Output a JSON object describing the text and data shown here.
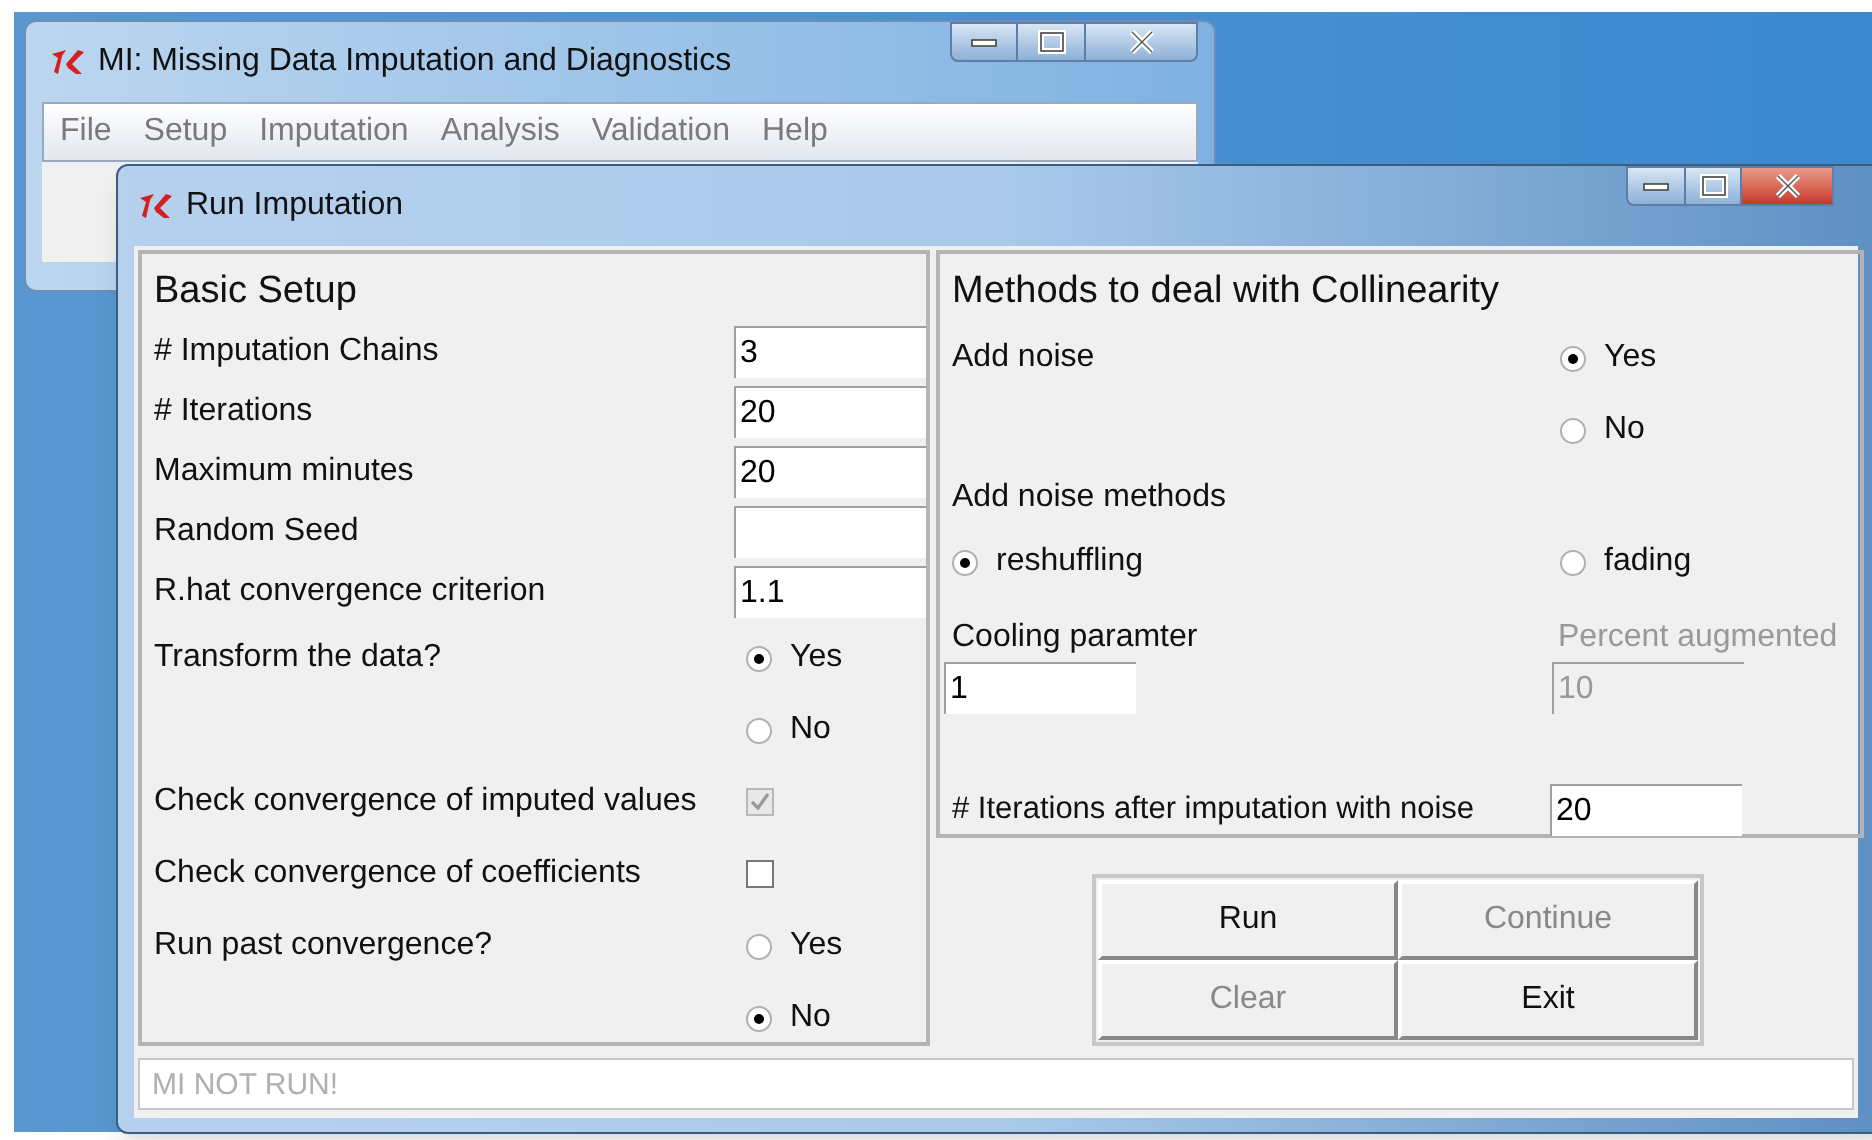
{
  "main_window": {
    "title": "MI: Missing Data Imputation and Diagnostics",
    "menu": [
      "File",
      "Setup",
      "Imputation",
      "Analysis",
      "Validation",
      "Help"
    ]
  },
  "dialog": {
    "title": "Run Imputation",
    "basic_setup": {
      "title": "Basic Setup",
      "fields": [
        {
          "label": "# Imputation Chains",
          "value": "3"
        },
        {
          "label": "# Iterations",
          "value": "20"
        },
        {
          "label": "Maximum minutes",
          "value": "20"
        },
        {
          "label": "Random Seed"
        },
        {
          "label": "R.hat convergence criterion",
          "value": "1.1"
        }
      ],
      "transform": {
        "label": "Transform the data?",
        "options": [
          {
            "label": "Yes",
            "selected": true
          },
          {
            "label": "No",
            "selected": false
          }
        ]
      },
      "checks": [
        {
          "label": "Check convergence of imputed values",
          "checked": true,
          "disabled": true
        },
        {
          "label": "Check convergence of coefficients",
          "checked": false,
          "disabled": false
        }
      ],
      "run_past": {
        "label": "Run past convergence?",
        "options": [
          {
            "label": "Yes",
            "selected": false
          },
          {
            "label": "No",
            "selected": true
          }
        ]
      }
    },
    "collinearity": {
      "title": "Methods to deal with Collinearity",
      "add_noise": {
        "label": "Add noise",
        "options": [
          {
            "label": "Yes",
            "selected": true
          },
          {
            "label": "No",
            "selected": false
          }
        ]
      },
      "methods": {
        "label": "Add noise methods",
        "options": [
          {
            "label": "reshuffling",
            "selected": true
          },
          {
            "label": "fading",
            "selected": false
          }
        ]
      },
      "cooling": {
        "label": "Cooling paramter",
        "value": "1",
        "disabled": false
      },
      "percent": {
        "label": "Percent augmented",
        "value": "10",
        "disabled": true
      },
      "iterations": {
        "label": "# Iterations after imputation with noise",
        "value": "20"
      }
    },
    "buttons": [
      {
        "label": "Run",
        "disabled": false
      },
      {
        "label": "Continue",
        "disabled": true
      },
      {
        "label": "Clear",
        "disabled": true
      },
      {
        "label": "Exit",
        "disabled": false
      }
    ],
    "status": {
      "placeholder": "MI NOT RUN!"
    }
  }
}
